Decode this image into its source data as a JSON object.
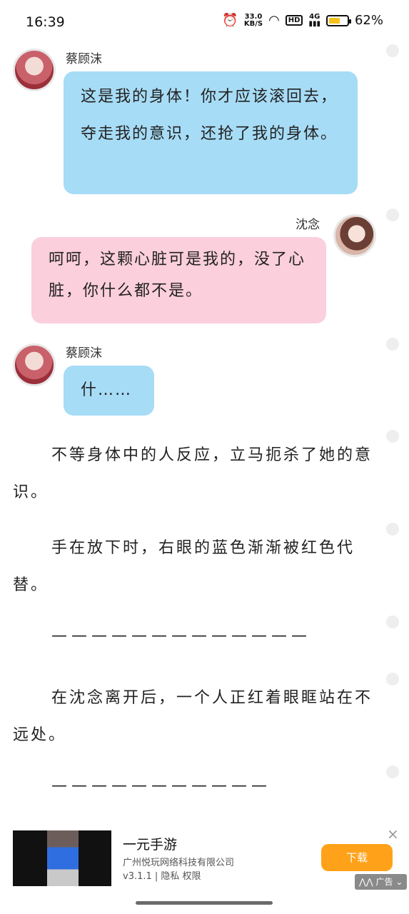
{
  "status_bar": {
    "time": "16:39",
    "net_speed_value": "33.0",
    "net_speed_unit": "KB/S",
    "hd_label": "HD",
    "signal_label": "4G",
    "battery_percent": "62%",
    "battery_level": 0.62
  },
  "chat": [
    {
      "speaker": "蔡顾沫",
      "text": "这是我的身体！你才应该滚回去，夺走我的意识，还抢了我的身体。"
    },
    {
      "speaker": "沈念",
      "text": "呵呵，这颗心脏可是我的，没了心脏，你什么都不是。"
    },
    {
      "speaker": "蔡顾沫",
      "text": "什……"
    }
  ],
  "narrative": [
    "不等身体中的人反应，立马扼杀了她的意识。",
    "手在放下时，右眼的蓝色渐渐被红色代替。",
    "—————————————",
    "在沈念离开后，一个人正红着眼眶站在不远处。",
    "———————————"
  ],
  "ad": {
    "title": "一元手游",
    "company": "广州悦玩网络科技有限公司",
    "meta": "v3.1.1 | 隐私 权限",
    "download_label": "下载",
    "close_icon": "×",
    "ad_label": "广告"
  },
  "colors": {
    "bubble_blue": "#a7dcf6",
    "bubble_pink": "#fbcfdc",
    "download_orange": "#ffa21a"
  }
}
